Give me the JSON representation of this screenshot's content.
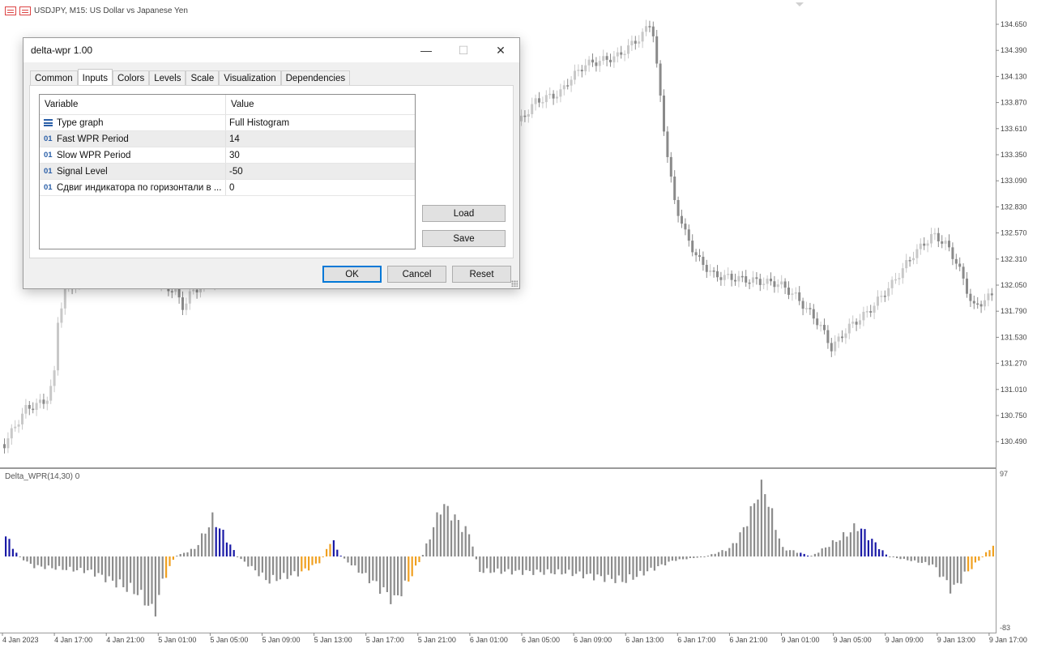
{
  "chart": {
    "title": "USDJPY, M15:  US Dollar vs Japanese Yen",
    "price_axis": [
      "134.650",
      "134.390",
      "134.130",
      "133.870",
      "133.610",
      "133.350",
      "133.090",
      "132.830",
      "132.570",
      "132.310",
      "132.050",
      "131.790",
      "131.530",
      "131.270",
      "131.010",
      "130.750",
      "130.490"
    ],
    "time_axis": [
      "4 Jan 2023",
      "4 Jan 17:00",
      "4 Jan 21:00",
      "5 Jan 01:00",
      "5 Jan 05:00",
      "5 Jan 09:00",
      "5 Jan 13:00",
      "5 Jan 17:00",
      "5 Jan 21:00",
      "6 Jan 01:00",
      "6 Jan 05:00",
      "6 Jan 09:00",
      "6 Jan 13:00",
      "6 Jan 17:00",
      "6 Jan 21:00",
      "9 Jan 01:00",
      "9 Jan 05:00",
      "9 Jan 09:00",
      "9 Jan 13:00",
      "9 Jan 17:00"
    ],
    "indicator_label": "Delta_WPR(14,30) 0",
    "indicator_axis": {
      "top": "97",
      "bottom": "-83"
    },
    "colors": {
      "candle": "#8a8a8a",
      "bull": "#c8c8c8",
      "hist_gray": "#8c8c8c",
      "hist_blue": "#1a1aa6",
      "hist_orange": "#f0a020"
    }
  },
  "dialog": {
    "title": "delta-wpr 1.00",
    "window_buttons": {
      "minimize": "—",
      "maximize": "☐",
      "close": "✕"
    },
    "tabs": [
      "Common",
      "Inputs",
      "Colors",
      "Levels",
      "Scale",
      "Visualization",
      "Dependencies"
    ],
    "active_tab": "Inputs",
    "table": {
      "headers": {
        "variable": "Variable",
        "value": "Value"
      },
      "rows": [
        {
          "icon": "list-icon",
          "variable": "Type graph",
          "value": "Full Histogram"
        },
        {
          "icon": "01",
          "variable": "Fast WPR Period",
          "value": "14"
        },
        {
          "icon": "01",
          "variable": "Slow WPR Period",
          "value": "30"
        },
        {
          "icon": "01",
          "variable": "Signal Level",
          "value": "-50"
        },
        {
          "icon": "01",
          "variable": "Сдвиг индикатора по горизонтали в ...",
          "value": "0"
        }
      ]
    },
    "buttons": {
      "load": "Load",
      "save": "Save",
      "ok": "OK",
      "cancel": "Cancel",
      "reset": "Reset"
    }
  }
}
